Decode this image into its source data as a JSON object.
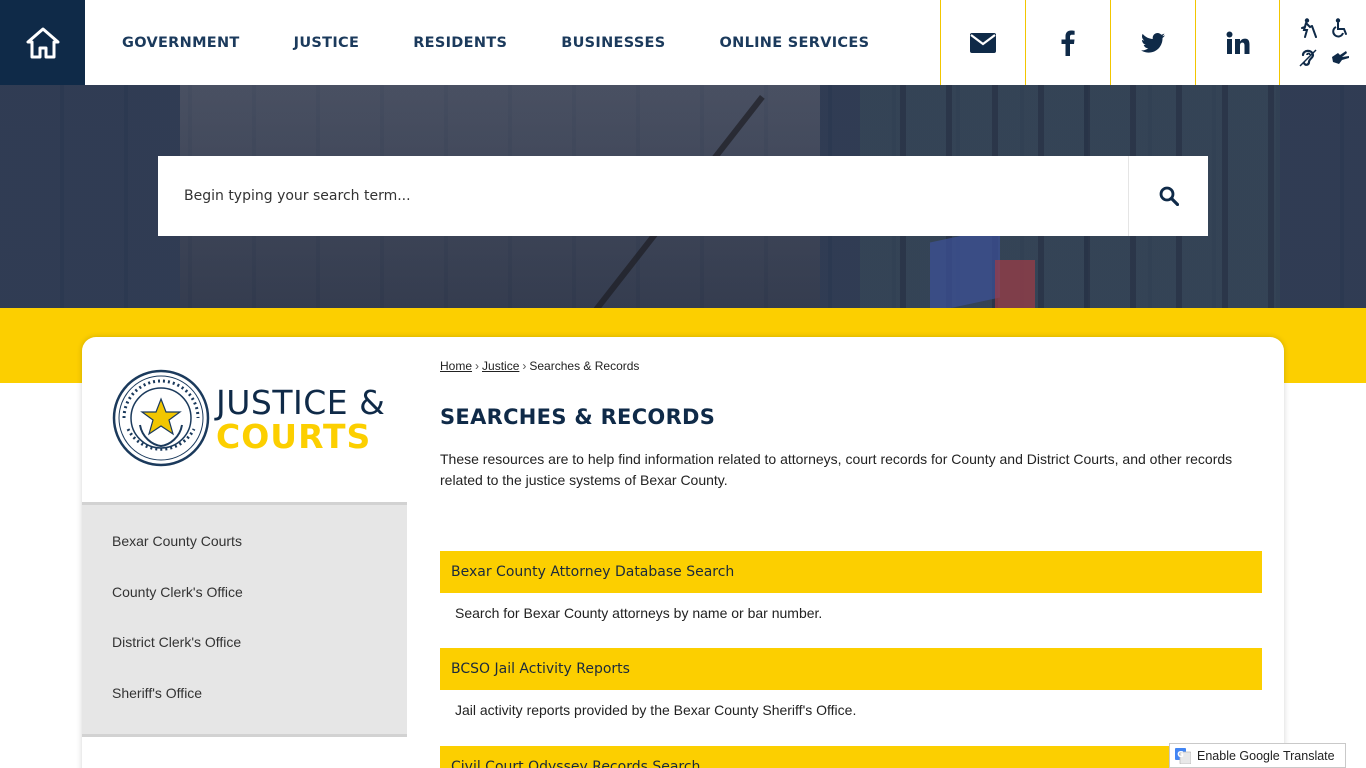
{
  "header": {
    "nav": [
      "GOVERNMENT",
      "JUSTICE",
      "RESIDENTS",
      "BUSINESSES",
      "ONLINE SERVICES"
    ],
    "icons": {
      "home": "home-icon",
      "social": [
        "email-icon",
        "facebook-icon",
        "twitter-icon",
        "linkedin-icon"
      ],
      "accessibility": [
        "blind-walk-icon",
        "wheelchair-icon",
        "hearing-icon",
        "sign-language-icon"
      ]
    },
    "colors": {
      "navy": "#0f2a48",
      "yellow": "#fccf00"
    }
  },
  "search": {
    "placeholder": "Begin typing your search term..."
  },
  "logo": {
    "line1": "JUSTICE &",
    "line2": "COURTS"
  },
  "sidebar": {
    "items": [
      {
        "label": "Bexar County Courts"
      },
      {
        "label": "County Clerk's Office"
      },
      {
        "label": "District Clerk's Office"
      },
      {
        "label": "Sheriff's Office"
      }
    ]
  },
  "breadcrumb": {
    "home": "Home",
    "justice": "Justice",
    "current": "Searches & Records",
    "sep": "›"
  },
  "main": {
    "title": "SEARCHES & RECORDS",
    "intro": "These resources are to help find information related to attorneys, court records for County and District Courts, and other records related to the justice systems of Bexar County.",
    "resources": [
      {
        "title": "Bexar County Attorney Database Search",
        "desc": "Search for Bexar County attorneys by name or bar number."
      },
      {
        "title": "BCSO Jail Activity Reports",
        "desc": "Jail activity reports provided by the Bexar County Sheriff's Office."
      },
      {
        "title": "Civil Court Odyssey Records Search",
        "desc": ""
      }
    ]
  },
  "translate": {
    "label": "Enable Google Translate"
  }
}
